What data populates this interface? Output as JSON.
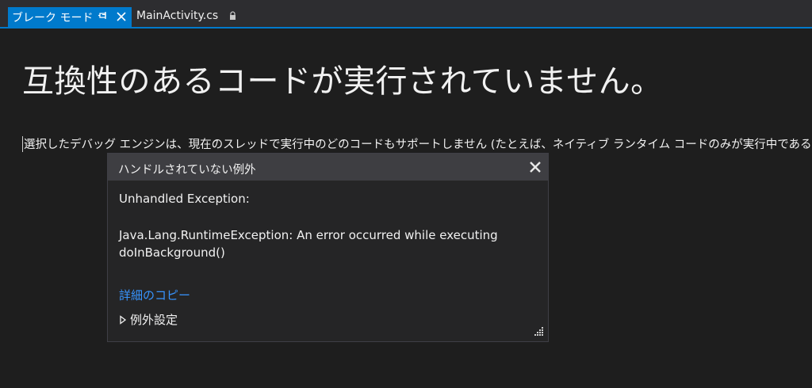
{
  "tabs": [
    {
      "label": "ブレーク モード",
      "active": true
    },
    {
      "label": "MainActivity.cs",
      "active": false
    }
  ],
  "main": {
    "heading": "互換性のあるコードが実行されていません。",
    "description": "選択したデバッグ エンジンは、現在のスレッドで実行中のどのコードもサポートしません (たとえば、ネイティブ ランタイム コードのみが実行中であるなど)。"
  },
  "exception_popup": {
    "title": "ハンドルされていない例外",
    "exception_label": "Unhandled Exception:",
    "message_line1": "Java.Lang.RuntimeException: An error occurred while executing",
    "message_line2": "doInBackground()",
    "copy_link": "詳細のコピー",
    "settings_label": "例外設定"
  },
  "colors": {
    "accent": "#007acc",
    "link": "#3794ff",
    "background": "#1e1e1e",
    "popup_background": "#252526",
    "popup_header": "#3e3e42"
  },
  "icons": [
    "pin-icon",
    "close-icon",
    "lock-icon",
    "triangle-right-icon",
    "resize-grip-icon"
  ]
}
